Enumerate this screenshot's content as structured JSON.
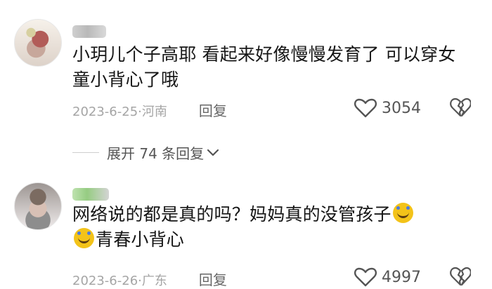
{
  "comments": [
    {
      "text": "小玥儿个子高耶 看起来好像慢慢发育了 可以穿女童小背心了哦",
      "date": "2023-6-25",
      "location": "河南",
      "separator": "·",
      "reply_label": "回复",
      "likes": "3054",
      "avatar_icon": "user-avatar"
    },
    {
      "text": "网络说的都是真的吗？妈妈真的没管孩子",
      "text_line2": "青春小背心",
      "date": "2023-6-26",
      "location": "广东",
      "separator": "·",
      "reply_label": "回复",
      "likes": "4997",
      "avatar_icon": "user-avatar"
    }
  ],
  "expand_replies": {
    "label": "展开 74 条回复",
    "icon": "chevron-down-icon"
  },
  "colors": {
    "text": "#161616",
    "meta": "#a5a5a5",
    "icon": "#555555",
    "emoji": "#f3c319"
  }
}
